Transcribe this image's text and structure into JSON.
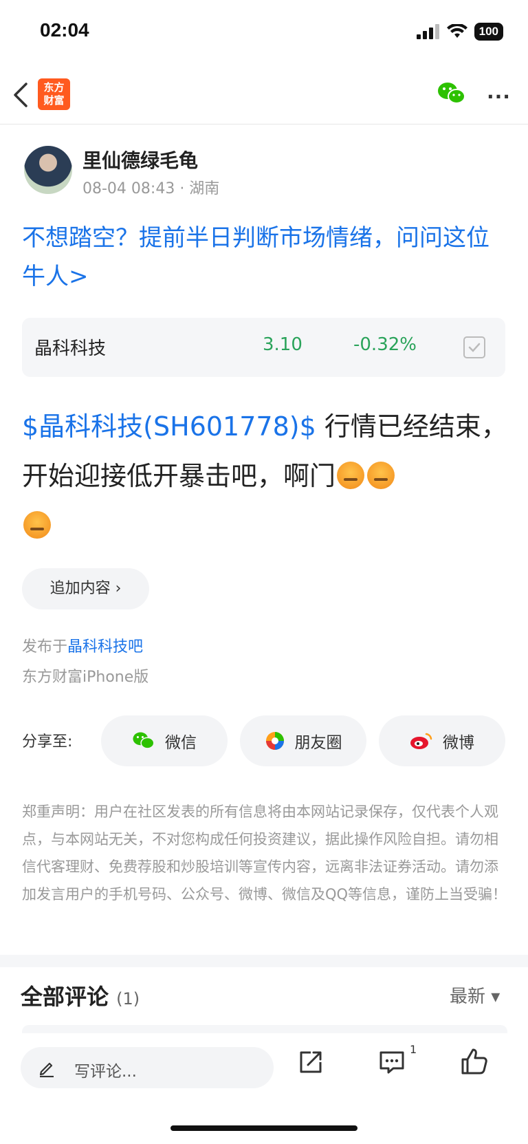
{
  "status": {
    "time": "02:04",
    "battery": "100"
  },
  "nav": {
    "app_logo_line1": "东方",
    "app_logo_line2": "财富"
  },
  "author": {
    "name": "里仙德绿毛龟",
    "meta": "08-04 08:43 · 湖南"
  },
  "promo": "不想踏空？提前半日判断市场情绪，问问这位牛人>",
  "stock": {
    "name": "晶科科技",
    "price": "3.10",
    "change": "-0.32%"
  },
  "post": {
    "tag": "$晶科科技(SH601778)$",
    "text": " 行情已经结束，开始迎接低开暴击吧，啊门"
  },
  "append_label": "追加内容 ›",
  "posted_in_prefix": "发布于",
  "posted_in_bar": "晶科科技吧",
  "client": "东方财富iPhone版",
  "share": {
    "label": "分享至:",
    "buttons": [
      "微信",
      "朋友圈",
      "微博"
    ]
  },
  "disclaimer": "郑重声明：用户在社区发表的所有信息将由本网站记录保存，仅代表个人观点，与本网站无关，不对您构成任何投资建议，据此操作风险自担。请勿相信代客理财、免费荐股和炒股培训等宣传内容，远离非法证券活动。请勿添加发言用户的手机号码、公众号、微博、微信及QQ等信息，谨防上当受骗！",
  "comments": {
    "title": "全部评论",
    "count": "(1)",
    "sort": "最新 ▾"
  },
  "bottom": {
    "placeholder": "写评论...",
    "comment_badge": "1"
  },
  "colors": {
    "accent_blue": "#1a73e8",
    "down_green": "#2aa35a",
    "brand_orange": "#ff5a1f"
  }
}
